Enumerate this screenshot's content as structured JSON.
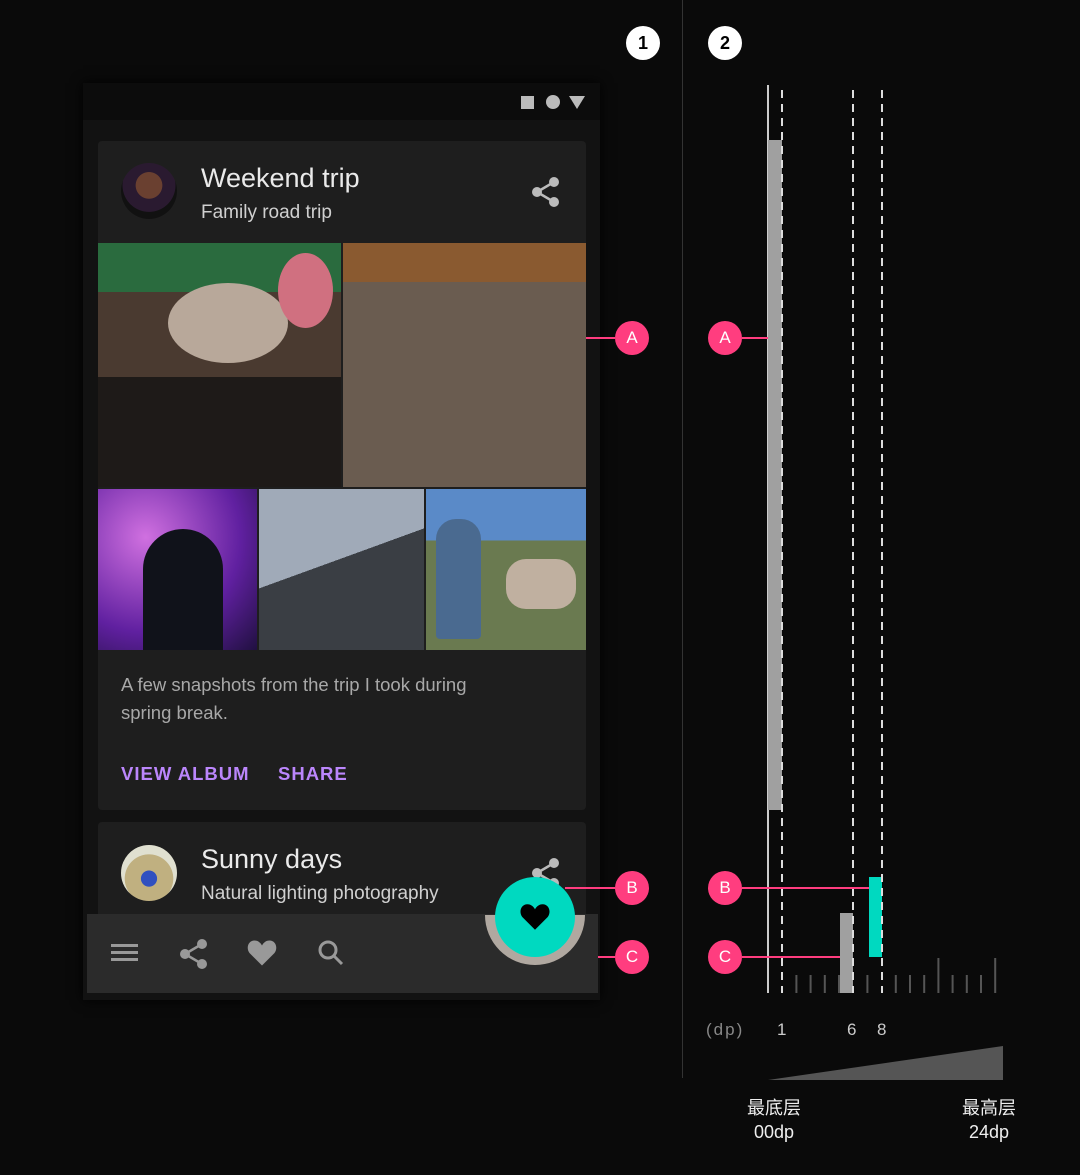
{
  "step_labels": [
    "1",
    "2"
  ],
  "status_icons": [
    "square-icon",
    "circle-icon",
    "triangle-icon"
  ],
  "card1": {
    "title": "Weekend trip",
    "subtitle": "Family road trip",
    "description_line1": "A few snapshots from the trip I took during",
    "description_line2": "spring break.",
    "actions": [
      "VIEW ALBUM",
      "SHARE"
    ]
  },
  "card2": {
    "title": "Sunny days",
    "subtitle": "Natural lighting photography"
  },
  "bottom_bar": {
    "icons": [
      "menu-icon",
      "share-icon",
      "heart-icon",
      "search-icon"
    ]
  },
  "fab": {
    "icon": "heart-icon",
    "color": "#00d9c0"
  },
  "markers": [
    "A",
    "B",
    "C"
  ],
  "elevation_chart": {
    "unit_label": "(dp)",
    "ticks": [
      "1",
      "6",
      "8"
    ],
    "elements": [
      {
        "marker": "A",
        "elevation_dp": 1,
        "color": "#a0a0a0"
      },
      {
        "marker": "B",
        "elevation_dp": 8,
        "color": "#00d9c0"
      },
      {
        "marker": "C",
        "elevation_dp": 6,
        "color": "#a0a0a0"
      }
    ],
    "low": {
      "label": "最底层",
      "value": "00dp"
    },
    "high": {
      "label": "最高层",
      "value": "24dp"
    }
  },
  "colors": {
    "accent": "#bb86fc",
    "marker": "#ff3d7f",
    "fab": "#00d9c0"
  }
}
